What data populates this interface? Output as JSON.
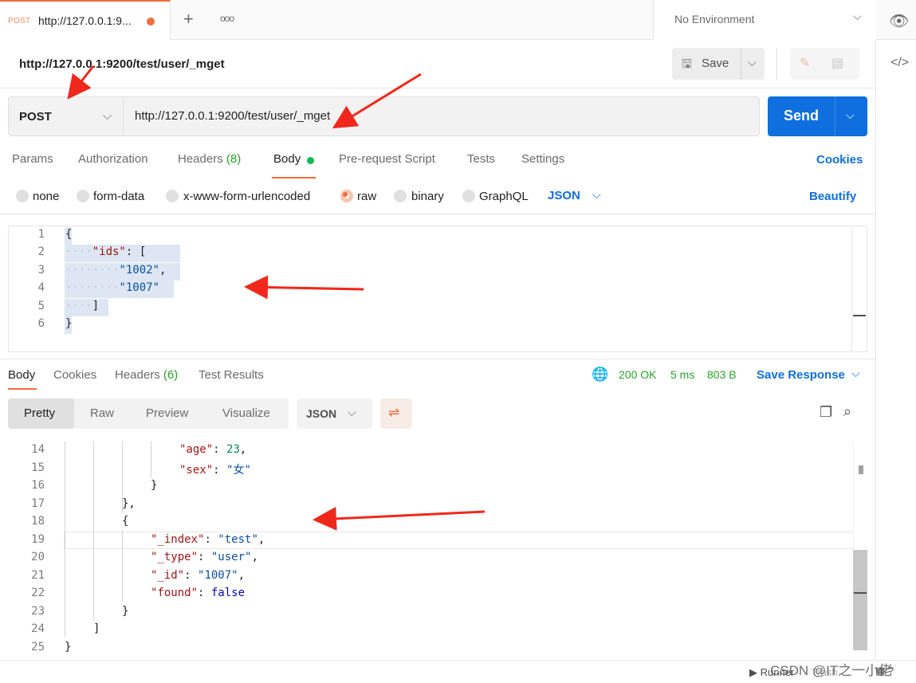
{
  "tab": {
    "method": "POST",
    "title": "http://127.0.0.1:9..."
  },
  "topbar": {
    "new_tab_icon": "+",
    "more_icon": "ooo",
    "environment": "No Environment"
  },
  "request": {
    "title": "http://127.0.0.1:9200/test/user/_mget",
    "save_label": "Save",
    "method": "POST",
    "url": "http://127.0.0.1:9200/test/user/_mget",
    "send_label": "Send"
  },
  "request_tabs": [
    {
      "label": "Params"
    },
    {
      "label": "Authorization"
    },
    {
      "label": "Headers",
      "count": "(8)"
    },
    {
      "label": "Body"
    },
    {
      "label": "Pre-request Script"
    },
    {
      "label": "Tests"
    },
    {
      "label": "Settings"
    }
  ],
  "cookies_label": "Cookies",
  "body_types": [
    "none",
    "form-data",
    "x-www-form-urlencoded",
    "raw",
    "binary",
    "GraphQL"
  ],
  "body_format": "JSON",
  "beautify_label": "Beautify",
  "request_body": {
    "line_numbers": [
      "1",
      "2",
      "3",
      "4",
      "5",
      "6"
    ],
    "lines": [
      {
        "indent": "",
        "parts": [
          {
            "t": "{",
            "c": ""
          }
        ]
      },
      {
        "indent": "····",
        "parts": [
          {
            "t": "\"ids\"",
            "c": "k"
          },
          {
            "t": ": [",
            "c": ""
          }
        ]
      },
      {
        "indent": "········",
        "parts": [
          {
            "t": "\"1002\"",
            "c": "s"
          },
          {
            "t": ",",
            "c": ""
          }
        ]
      },
      {
        "indent": "········",
        "parts": [
          {
            "t": "\"1007\"",
            "c": "s"
          }
        ]
      },
      {
        "indent": "····",
        "parts": [
          {
            "t": "]",
            "c": ""
          }
        ]
      },
      {
        "indent": "",
        "parts": [
          {
            "t": "}",
            "c": ""
          }
        ]
      }
    ]
  },
  "response_tabs": [
    {
      "label": "Body"
    },
    {
      "label": "Cookies"
    },
    {
      "label": "Headers",
      "count": "(6)"
    },
    {
      "label": "Test Results"
    }
  ],
  "response_status": {
    "status": "200 OK",
    "time": "5 ms",
    "size": "803 B"
  },
  "save_response_label": "Save Response",
  "view_modes": [
    "Pretty",
    "Raw",
    "Preview",
    "Visualize"
  ],
  "response_format": "JSON",
  "response_body": {
    "lines": [
      {
        "num": "14",
        "parts": [
          {
            "t": "\"age\"",
            "c": "k"
          },
          {
            "t": ": ",
            "c": ""
          },
          {
            "t": "23",
            "c": "n"
          },
          {
            "t": ",",
            "c": ""
          }
        ]
      },
      {
        "num": "15",
        "parts": [
          {
            "t": "\"sex\"",
            "c": "k"
          },
          {
            "t": ": ",
            "c": ""
          },
          {
            "t": "\"女\"",
            "c": "s"
          }
        ]
      },
      {
        "num": "16",
        "parts": [
          {
            "t": "}",
            "c": ""
          }
        ]
      },
      {
        "num": "17",
        "parts": [
          {
            "t": "},",
            "c": ""
          }
        ]
      },
      {
        "num": "18",
        "parts": [
          {
            "t": "{",
            "c": ""
          }
        ]
      },
      {
        "num": "19",
        "parts": [
          {
            "t": "\"_index\"",
            "c": "k"
          },
          {
            "t": ": ",
            "c": ""
          },
          {
            "t": "\"test\"",
            "c": "s"
          },
          {
            "t": ",",
            "c": ""
          }
        ]
      },
      {
        "num": "20",
        "parts": [
          {
            "t": "\"_type\"",
            "c": "k"
          },
          {
            "t": ": ",
            "c": ""
          },
          {
            "t": "\"user\"",
            "c": "s"
          },
          {
            "t": ",",
            "c": ""
          }
        ]
      },
      {
        "num": "21",
        "parts": [
          {
            "t": "\"_id\"",
            "c": "k"
          },
          {
            "t": ": ",
            "c": ""
          },
          {
            "t": "\"1007\"",
            "c": "s"
          },
          {
            "t": ",",
            "c": ""
          }
        ]
      },
      {
        "num": "22",
        "parts": [
          {
            "t": "\"found\"",
            "c": "k"
          },
          {
            "t": ": ",
            "c": ""
          },
          {
            "t": "false",
            "c": "b"
          }
        ]
      },
      {
        "num": "23",
        "parts": [
          {
            "t": "}",
            "c": ""
          }
        ]
      },
      {
        "num": "24",
        "parts": [
          {
            "t": "]",
            "c": ""
          }
        ]
      },
      {
        "num": "25",
        "parts": [
          {
            "t": "}",
            "c": ""
          }
        ]
      }
    ]
  },
  "footer": {
    "runner": "Runner",
    "trash": "Trash",
    "watermark": "CSDN @IT之一小佬"
  },
  "colors": {
    "accent_orange": "#f26b3a",
    "primary_blue": "#0f6fde",
    "success_green": "#27a327"
  }
}
